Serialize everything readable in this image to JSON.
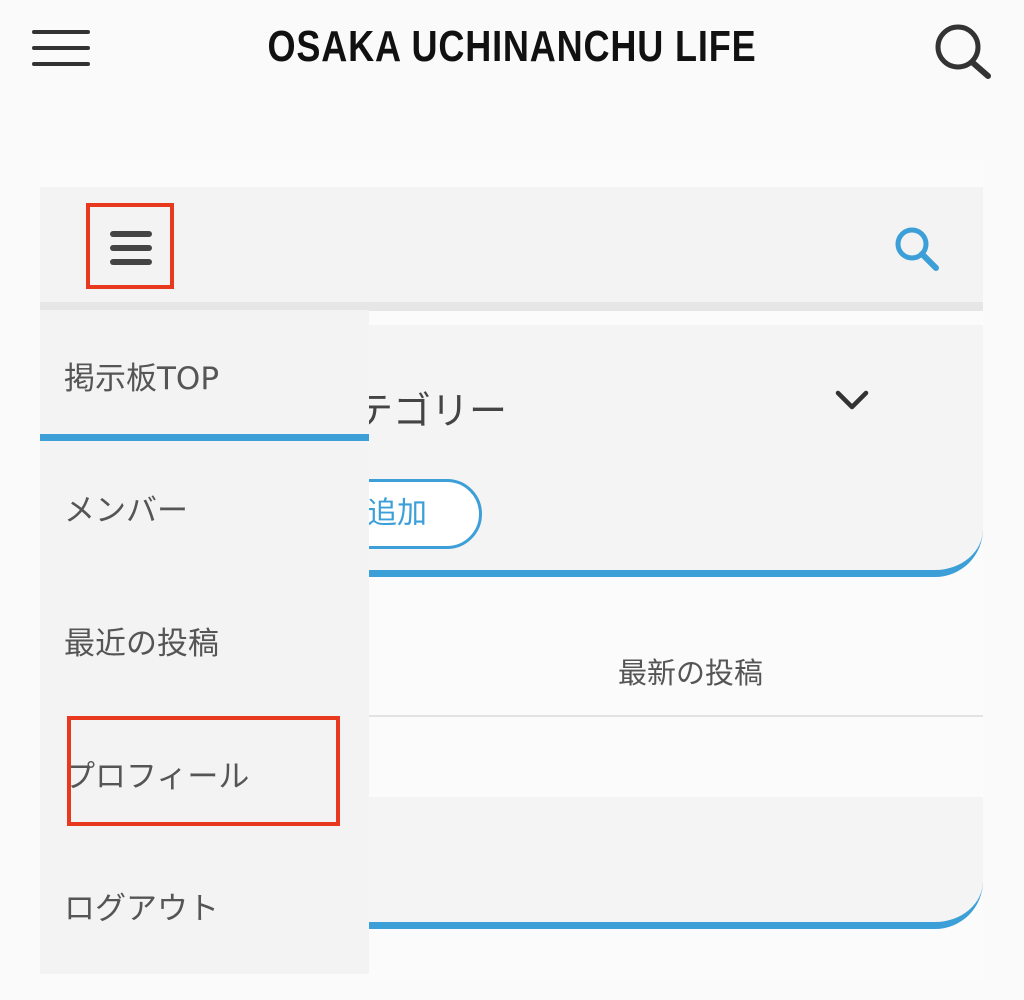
{
  "site": {
    "title": "OSAKA UCHINANCHU LIFE",
    "menu_icon": "hamburger-icon",
    "search_icon": "search-icon"
  },
  "forum": {
    "menu_icon": "hamburger-icon",
    "search_icon": "search-icon",
    "search_color": "#3d9fd8",
    "category_label": "テゴリー",
    "category_toggle_icon": "chevron-down-icon",
    "add_label": "追加",
    "latest_posts_label": "最新の投稿"
  },
  "menu": {
    "items": [
      {
        "label": "掲示板TOP",
        "active": true
      },
      {
        "label": "メンバー"
      },
      {
        "label": "最近の投稿"
      },
      {
        "label": "プロフィール",
        "highlighted": true
      },
      {
        "label": "ログアウト"
      }
    ]
  },
  "colors": {
    "accent": "#3d9fd8",
    "highlight": "#e8381e"
  }
}
